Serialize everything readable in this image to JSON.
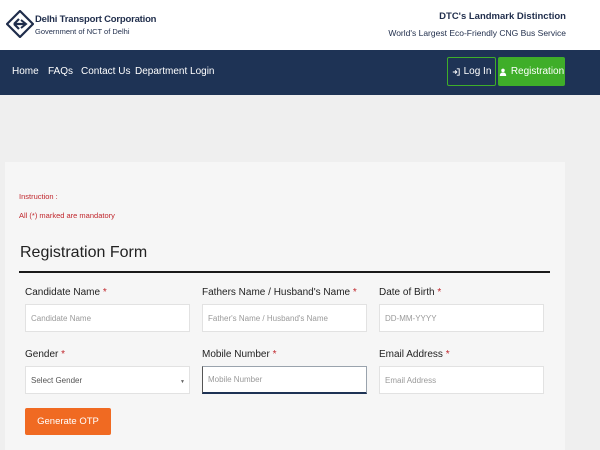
{
  "brand": {
    "name": "Delhi Transport Corporation",
    "subtitle": "Government of NCT of Delhi",
    "distinction_title": "DTC's Landmark Distinction",
    "distinction_subtitle": "World's Largest Eco-Friendly CNG Bus Service"
  },
  "nav": {
    "links": [
      "Home",
      "FAQs",
      "Contact Us",
      "Department Login"
    ],
    "login_label": "Log In",
    "registration_label": "Registration",
    "colors": {
      "nav_bg": "#1e3355",
      "accent_green": "#3fae29"
    }
  },
  "instructions": {
    "heading": "Instruction :",
    "mandatory_note": "All (*) marked are mandatory"
  },
  "form": {
    "title": "Registration Form",
    "required_marker": "*",
    "fields": {
      "candidate_name": {
        "label": "Candidate Name",
        "placeholder": "Candidate Name"
      },
      "father_name": {
        "label": "Fathers Name / Husband's Name",
        "placeholder": "Father's Name / Husband's Name"
      },
      "dob": {
        "label": "Date of Birth",
        "placeholder": "DD-MM-YYYY"
      },
      "gender": {
        "label": "Gender",
        "selected": "Select Gender"
      },
      "mobile": {
        "label": "Mobile Number",
        "placeholder": "Mobile Number"
      },
      "email": {
        "label": "Email Address",
        "placeholder": "Email Address"
      }
    },
    "generate_otp_label": "Generate OTP",
    "colors": {
      "required": "#c0262c",
      "otp_button": "#f06a22"
    }
  }
}
